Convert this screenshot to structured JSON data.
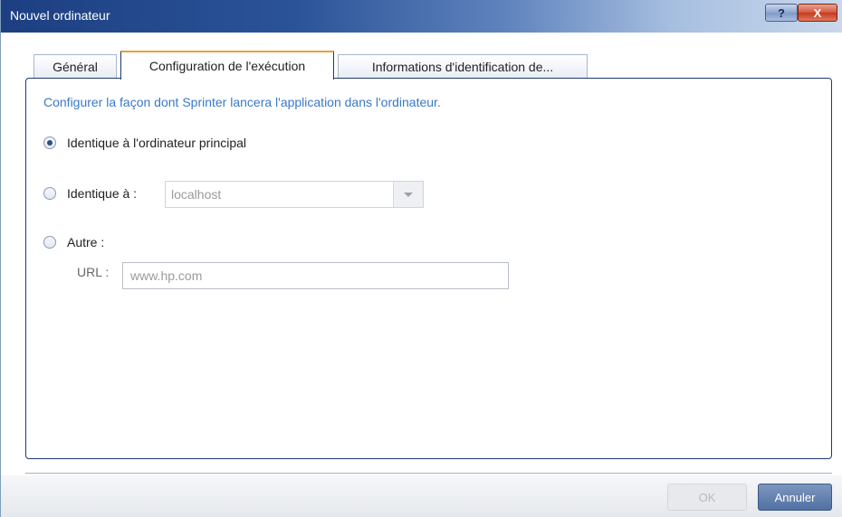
{
  "window": {
    "title": "Nouvel ordinateur",
    "help_label": "?",
    "close_label": "X"
  },
  "tabs": [
    {
      "label": "Général"
    },
    {
      "label": "Configuration de l'exécution"
    },
    {
      "label": "Informations d'identification de..."
    }
  ],
  "panel": {
    "description": "Configurer la façon dont Sprinter lancera l'application dans l'ordinateur.",
    "options": [
      {
        "label": "Identique à l'ordinateur principal",
        "selected": true
      },
      {
        "label": "Identique à :",
        "selected": false
      },
      {
        "label": "Autre :",
        "selected": false
      }
    ],
    "combo_value": "localhost",
    "url_label": "URL :",
    "url_value": "www.hp.com"
  },
  "footer": {
    "ok_label": "OK",
    "cancel_label": "Annuler"
  },
  "colors": {
    "accent": "#3a78c7",
    "tab_active_top": "#e3a13a",
    "border": "#1f3a6e"
  }
}
